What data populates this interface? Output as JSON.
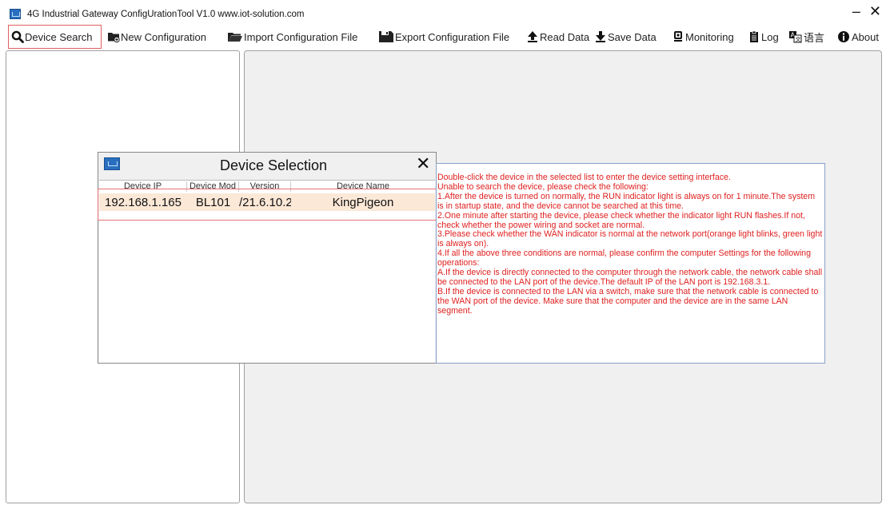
{
  "window": {
    "title": "4G Industrial Gateway ConfigUrationTool V1.0 www.iot-solution.com",
    "minimize_glyph": "–",
    "close_glyph": "✕"
  },
  "toolbar": {
    "items": [
      {
        "label": "Device Search",
        "icon": "search-icon"
      },
      {
        "label": "New Configuration",
        "icon": "new-folder-icon"
      },
      {
        "label": "Import Configuration File",
        "icon": "folder-open-icon"
      },
      {
        "label": "Export Configuration File",
        "icon": "save-disk-icon"
      },
      {
        "label": "Read Data",
        "icon": "upload-arrow-icon"
      },
      {
        "label": "Save Data",
        "icon": "download-arrow-icon"
      },
      {
        "label": "Monitoring",
        "icon": "monitor-icon"
      },
      {
        "label": "Log",
        "icon": "clipboard-icon"
      },
      {
        "label": "语言",
        "icon": "translate-icon"
      },
      {
        "label": "About",
        "icon": "info-icon"
      }
    ],
    "active_index": 0
  },
  "dialog": {
    "title": "Device Selection",
    "close_glyph": "✕",
    "columns": [
      "Device IP",
      "Device Mod",
      "Version",
      "Device Name"
    ],
    "rows": [
      {
        "ip": "192.168.1.165",
        "model": "BL101",
        "version": "/21.6.10.2",
        "name": "KingPigeon"
      }
    ]
  },
  "info": {
    "lines": [
      "Double-click the device in the selected list to enter the device setting interface.",
      "Unable to search the device, please check the following:",
      "1.After the device is turned on normally, the RUN indicator light is always on for 1 minute.The system is in startup state, and the device cannot be searched at this time.",
      "2.One minute after starting the device, please check whether the indicator light RUN flashes.If not, check whether the power wiring and socket are normal.",
      "3.Please check whether the WAN indicator is normal at the network port(orange light blinks, green light is always on).",
      "4.If all the above three conditions are normal, please confirm the computer Settings for the following operations:",
      "A.If the device is directly connected to the computer through the network cable, the network cable shall be connected to the LAN port of the device.The default IP of the LAN port is 192.168.3.1.",
      "B.If the device is connected to the LAN via a switch, make sure that the network cable is connected to the WAN port of the device. Make sure that the computer and the device are in the same LAN segment."
    ]
  },
  "colors": {
    "info_text": "#e02020",
    "selected_row": "#fbe8d7",
    "highlight_outline": "#e57373",
    "panel_bg": "#f0f0f0"
  }
}
